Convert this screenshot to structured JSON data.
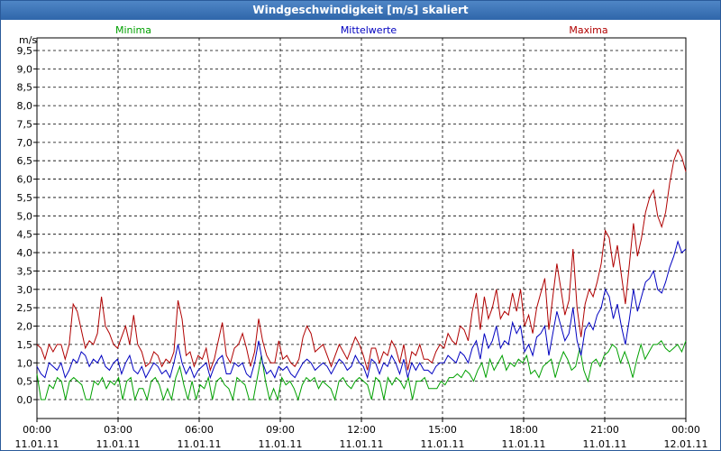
{
  "window": {
    "title": "Windgeschwindigkeit [m/s] skaliert"
  },
  "colors": {
    "minima": "#00a000",
    "mittelwerte": "#0000c0",
    "maxima": "#b00000"
  },
  "chart_data": {
    "type": "line",
    "title": "Windgeschwindigkeit [m/s] skaliert",
    "ylabel": "m/s",
    "xlabel": "",
    "ylim": [
      0,
      9.5
    ],
    "xlim_hours": [
      0,
      24
    ],
    "grid": true,
    "legend": "top",
    "yticks": [
      "0,0",
      "0,5",
      "1,0",
      "1,5",
      "2,0",
      "2,5",
      "3,0",
      "3,5",
      "4,0",
      "4,5",
      "5,0",
      "5,5",
      "6,0",
      "6,5",
      "7,0",
      "7,5",
      "8,0",
      "8,5",
      "9,0",
      "9,5"
    ],
    "xticks": [
      {
        "time": "00:00",
        "date": "11.01.11"
      },
      {
        "time": "03:00",
        "date": "11.01.11"
      },
      {
        "time": "06:00",
        "date": "11.01.11"
      },
      {
        "time": "09:00",
        "date": "11.01.11"
      },
      {
        "time": "12:00",
        "date": "11.01.11"
      },
      {
        "time": "15:00",
        "date": "11.01.11"
      },
      {
        "time": "18:00",
        "date": "11.01.11"
      },
      {
        "time": "21:00",
        "date": "11.01.11"
      },
      {
        "time": "00:00",
        "date": "12.01.11"
      }
    ],
    "series": [
      {
        "name": "Minima",
        "key": "minima",
        "values": [
          0.7,
          0.0,
          0.0,
          0.4,
          0.3,
          0.6,
          0.5,
          0.0,
          0.5,
          0.6,
          0.5,
          0.4,
          0.0,
          0.0,
          0.5,
          0.4,
          0.6,
          0.3,
          0.5,
          0.4,
          0.6,
          0.0,
          0.5,
          0.6,
          0.0,
          0.3,
          0.3,
          0.0,
          0.5,
          0.6,
          0.4,
          0.0,
          0.3,
          0.0,
          0.6,
          0.9,
          0.4,
          0.0,
          0.5,
          0.0,
          0.4,
          0.3,
          0.6,
          0.0,
          0.5,
          0.6,
          0.4,
          0.3,
          0.0,
          0.6,
          0.5,
          0.4,
          0.0,
          0.0,
          0.6,
          1.2,
          0.5,
          0.0,
          0.3,
          0.0,
          0.6,
          0.4,
          0.5,
          0.3,
          0.0,
          0.4,
          0.6,
          0.5,
          0.6,
          0.3,
          0.5,
          0.4,
          0.3,
          0.0,
          0.5,
          0.6,
          0.4,
          0.3,
          0.5,
          0.6,
          0.5,
          0.4,
          0.0,
          0.6,
          0.5,
          0.0,
          0.6,
          0.4,
          0.6,
          0.5,
          0.3,
          0.6,
          0.0,
          0.5,
          0.5,
          0.6,
          0.3,
          0.3,
          0.3,
          0.5,
          0.4,
          0.6,
          0.6,
          0.7,
          0.6,
          0.8,
          0.7,
          0.5,
          0.8,
          1.0,
          0.6,
          1.1,
          0.8,
          1.0,
          1.2,
          0.8,
          1.0,
          0.9,
          1.1,
          1.0,
          1.2,
          0.7,
          0.8,
          0.6,
          0.9,
          1.0,
          1.1,
          0.6,
          1.0,
          1.3,
          1.1,
          0.8,
          0.9,
          1.4,
          0.8,
          0.5,
          1.0,
          1.1,
          0.9,
          1.2,
          1.3,
          1.5,
          1.4,
          1.0,
          1.3,
          1.0,
          0.6,
          1.1,
          1.5,
          1.1,
          1.3,
          1.5,
          1.5,
          1.6,
          1.4,
          1.3,
          1.4,
          1.5,
          1.3,
          1.6
        ]
      },
      {
        "name": "Mittelwerte",
        "key": "mittelwerte",
        "values": [
          0.9,
          0.7,
          0.6,
          1.0,
          0.9,
          0.8,
          1.0,
          0.6,
          0.8,
          1.1,
          1.0,
          1.3,
          1.2,
          0.9,
          1.1,
          1.0,
          1.2,
          0.9,
          0.8,
          1.0,
          1.1,
          0.7,
          1.0,
          1.2,
          0.8,
          0.7,
          0.9,
          0.6,
          0.8,
          1.0,
          0.9,
          0.7,
          0.8,
          0.6,
          1.0,
          1.5,
          1.0,
          0.7,
          0.9,
          0.6,
          0.8,
          0.9,
          1.0,
          0.6,
          0.9,
          1.1,
          1.2,
          0.7,
          0.7,
          1.0,
          0.9,
          1.0,
          0.7,
          0.6,
          1.0,
          1.6,
          1.0,
          0.7,
          0.8,
          0.6,
          0.9,
          0.8,
          0.9,
          0.7,
          0.6,
          0.8,
          1.0,
          1.1,
          1.0,
          0.8,
          0.9,
          1.0,
          0.9,
          0.7,
          0.9,
          1.1,
          1.0,
          0.8,
          0.9,
          1.2,
          1.0,
          0.9,
          0.6,
          1.1,
          1.0,
          0.7,
          1.0,
          0.9,
          1.2,
          1.0,
          0.7,
          1.1,
          0.6,
          1.0,
          0.8,
          1.0,
          0.8,
          0.8,
          0.7,
          0.9,
          1.0,
          1.0,
          1.2,
          1.1,
          1.0,
          1.3,
          1.2,
          1.0,
          1.4,
          1.6,
          1.1,
          1.8,
          1.4,
          1.6,
          2.0,
          1.4,
          1.6,
          1.5,
          2.1,
          1.8,
          2.0,
          1.3,
          1.5,
          1.2,
          1.7,
          1.8,
          2.0,
          1.2,
          1.8,
          2.4,
          2.0,
          1.6,
          1.8,
          2.5,
          1.6,
          1.2,
          1.9,
          2.1,
          1.9,
          2.3,
          2.5,
          3.0,
          2.8,
          2.2,
          2.6,
          2.0,
          1.5,
          2.2,
          3.0,
          2.4,
          2.8,
          3.2,
          3.3,
          3.5,
          3.0,
          2.9,
          3.2,
          3.6,
          3.9,
          4.3,
          4.0,
          4.1
        ]
      },
      {
        "name": "Maxima",
        "key": "maxima",
        "values": [
          1.5,
          1.4,
          1.1,
          1.5,
          1.3,
          1.5,
          1.5,
          1.1,
          1.5,
          2.6,
          2.4,
          1.9,
          1.4,
          1.6,
          1.5,
          1.8,
          2.8,
          2.0,
          1.8,
          1.5,
          1.4,
          1.7,
          2.0,
          1.5,
          2.3,
          1.5,
          1.3,
          0.9,
          1.0,
          1.3,
          1.2,
          0.9,
          1.1,
          1.0,
          1.3,
          2.7,
          2.2,
          1.2,
          1.3,
          0.9,
          1.2,
          1.1,
          1.4,
          0.8,
          1.1,
          1.6,
          2.1,
          1.2,
          1.0,
          1.4,
          1.5,
          1.8,
          1.4,
          0.9,
          1.3,
          2.2,
          1.6,
          1.2,
          1.0,
          1.0,
          1.6,
          1.1,
          1.2,
          1.0,
          0.9,
          1.1,
          1.7,
          2.0,
          1.8,
          1.3,
          1.4,
          1.5,
          1.2,
          0.9,
          1.2,
          1.5,
          1.3,
          1.1,
          1.4,
          1.7,
          1.5,
          1.2,
          0.8,
          1.4,
          1.4,
          1.0,
          1.3,
          1.2,
          1.6,
          1.4,
          1.0,
          1.5,
          0.8,
          1.3,
          1.2,
          1.5,
          1.1,
          1.1,
          1.0,
          1.3,
          1.5,
          1.4,
          1.8,
          1.6,
          1.5,
          2.0,
          1.9,
          1.6,
          2.4,
          2.9,
          1.9,
          2.8,
          2.2,
          2.5,
          3.0,
          2.2,
          2.4,
          2.3,
          2.9,
          2.4,
          3.0,
          2.0,
          2.3,
          1.8,
          2.5,
          2.9,
          3.3,
          1.9,
          2.8,
          3.7,
          3.0,
          2.3,
          2.7,
          4.1,
          2.5,
          1.7,
          2.6,
          3.0,
          2.8,
          3.2,
          3.7,
          4.6,
          4.4,
          3.6,
          4.2,
          3.4,
          2.6,
          3.7,
          4.8,
          3.9,
          4.4,
          5.1,
          5.5,
          5.7,
          5.0,
          4.7,
          5.1,
          5.9,
          6.5,
          6.8,
          6.6,
          6.2
        ]
      }
    ]
  }
}
